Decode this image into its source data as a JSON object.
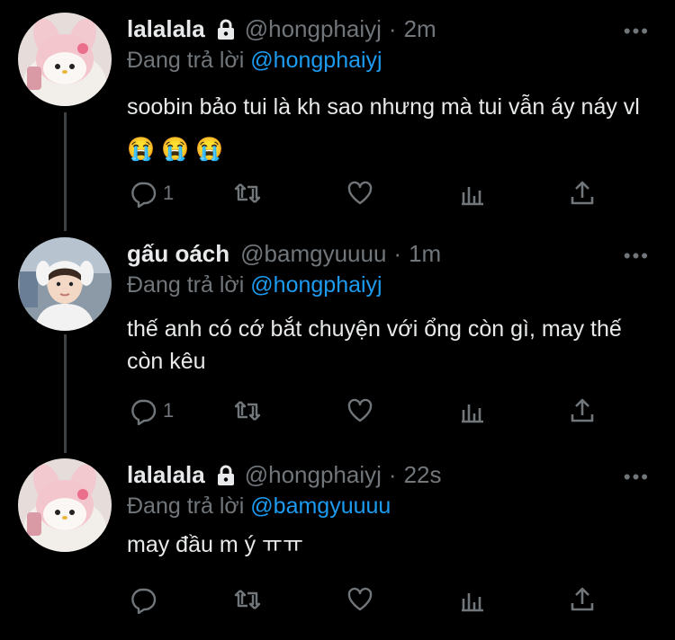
{
  "tweets": [
    {
      "name": "lalalala",
      "protected": true,
      "handle": "@hongphaiyj",
      "time": "2m",
      "reply_prefix": "Đang trả lời",
      "reply_to": "@hongphaiyj",
      "text": "soobin bảo tui là kh sao nhưng mà tui vẫn áy náy vl😭 😭 😭",
      "reply_count": "1",
      "avatar": "melody-icon"
    },
    {
      "name": "gấu oách",
      "protected": false,
      "handle": "@bamgyuuuu",
      "time": "1m",
      "reply_prefix": "Đang trả lời",
      "reply_to": "@hongphaiyj",
      "text": "thế anh có cớ bắt chuyện với ổng còn gì, may thế còn kêu",
      "reply_count": "1",
      "avatar": "person-photo"
    },
    {
      "name": "lalalala",
      "protected": true,
      "handle": "@hongphaiyj",
      "time": "22s",
      "reply_prefix": "Đang trả lời",
      "reply_to": "@bamgyuuuu",
      "text": "may đầu m ý ㅠㅠ",
      "reply_count": "",
      "avatar": "melody-icon"
    }
  ],
  "colors": {
    "background": "#000000",
    "text": "#e7e9ea",
    "muted": "#71767b",
    "accent": "#1d9bf0"
  },
  "more_glyph": "•••"
}
